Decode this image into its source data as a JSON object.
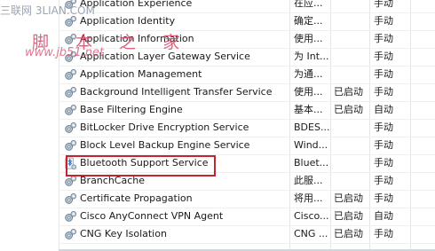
{
  "watermark": {
    "line1": "三联网 3LIAN.COM",
    "line2": "脚 本 之 家",
    "line3": "www.jb51.net"
  },
  "services": [
    {
      "name": "Application Experience",
      "desc": "在应...",
      "status": "",
      "startup": "手动"
    },
    {
      "name": "Application Identity",
      "desc": "确定...",
      "status": "",
      "startup": "手动"
    },
    {
      "name": "Application Information",
      "desc": "使用...",
      "status": "",
      "startup": "手动"
    },
    {
      "name": "Application Layer Gateway Service",
      "desc": "为 Int...",
      "status": "",
      "startup": "手动"
    },
    {
      "name": "Application Management",
      "desc": "为通...",
      "status": "",
      "startup": "手动"
    },
    {
      "name": "Background Intelligent Transfer Service",
      "desc": "使用...",
      "status": "已启动",
      "startup": "手动"
    },
    {
      "name": "Base Filtering Engine",
      "desc": "基本...",
      "status": "已启动",
      "startup": "自动"
    },
    {
      "name": "BitLocker Drive Encryption Service",
      "desc": "BDES...",
      "status": "",
      "startup": "手动"
    },
    {
      "name": "Block Level Backup Engine Service",
      "desc": "Wind...",
      "status": "",
      "startup": "手动"
    },
    {
      "name": "Bluetooth Support Service",
      "desc": "Bluet...",
      "status": "",
      "startup": "手动"
    },
    {
      "name": "BranchCache",
      "desc": "此服...",
      "status": "",
      "startup": "手动"
    },
    {
      "name": "Certificate Propagation",
      "desc": "将用...",
      "status": "已启动",
      "startup": "手动"
    },
    {
      "name": "Cisco AnyConnect VPN Agent",
      "desc": "Cisco...",
      "status": "已启动",
      "startup": "自动"
    },
    {
      "name": "CNG Key Isolation",
      "desc": "CNG ...",
      "status": "已启动",
      "startup": "手动"
    }
  ],
  "icons": {
    "service": "gear-icon",
    "bluetooth": "bluetooth-service-icon"
  },
  "colors": {
    "highlight": "#c0262d",
    "watermark": "#d64a6a"
  }
}
